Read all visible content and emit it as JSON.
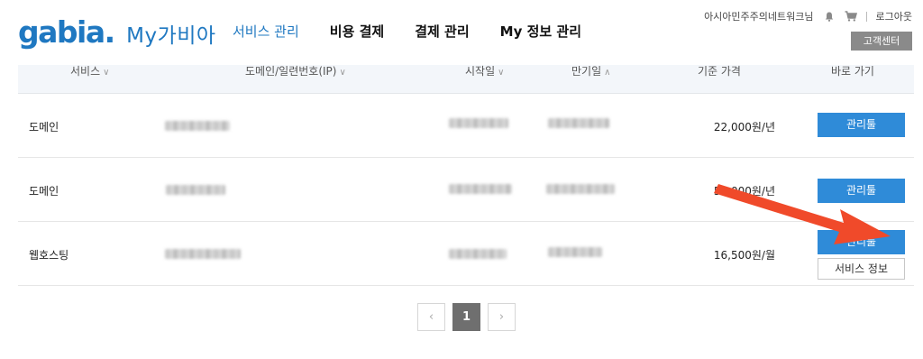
{
  "header": {
    "logo_text": "gabia",
    "logo_dot": ".",
    "logo_sub": "My가비아",
    "nav": [
      {
        "label": "서비스 관리",
        "active": true
      },
      {
        "label": "비용 결제",
        "active": false
      },
      {
        "label": "결제 관리",
        "active": false
      },
      {
        "label": "My 정보 관리",
        "active": false
      }
    ],
    "username": "아시아민주주의네트워크님",
    "logout_label": "로그아웃",
    "cs_label": "고객센터"
  },
  "table": {
    "columns": [
      {
        "label": "서비스",
        "sort": "∨"
      },
      {
        "label": "도메인/일련번호(IP)",
        "sort": "∨"
      },
      {
        "label": "시작일",
        "sort": "∨"
      },
      {
        "label": "만기일",
        "sort": "∧"
      },
      {
        "label": "기준 가격",
        "sort": ""
      },
      {
        "label": "바로 가기",
        "sort": ""
      }
    ],
    "rows": [
      {
        "service": "도메인",
        "price": "22,000원/년",
        "manage_label": "관리툴",
        "info_label": ""
      },
      {
        "service": "도메인",
        "price": "55,000원/년",
        "manage_label": "관리툴",
        "info_label": ""
      },
      {
        "service": "웹호스팅",
        "price": "16,500원/월",
        "manage_label": "관리툴",
        "info_label": "서비스 정보"
      }
    ]
  },
  "pagination": {
    "prev": "‹",
    "current": "1",
    "next": "›"
  },
  "colors": {
    "brand": "#1f78c1",
    "button": "#2f8bd8",
    "annotation_arrow": "#f04a2a"
  },
  "icons": [
    "bell-icon",
    "cart-icon",
    "arrow-annotation"
  ]
}
